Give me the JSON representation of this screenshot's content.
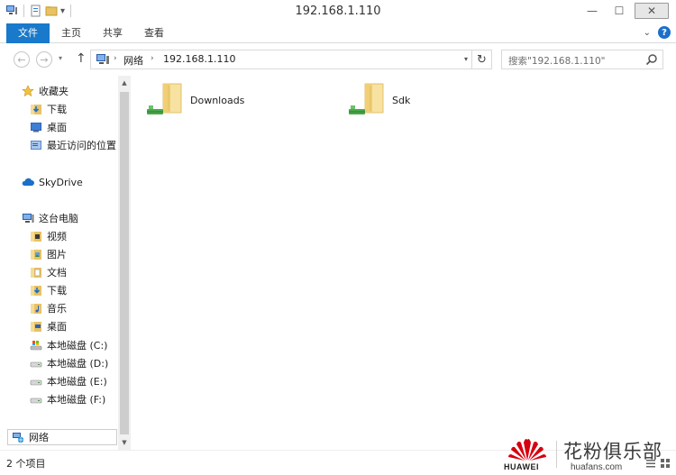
{
  "window": {
    "title": "192.168.1.110",
    "controls": {
      "minimize": "—",
      "maximize": "☐",
      "close": "✕"
    }
  },
  "ribbon": {
    "tabs": [
      "文件",
      "主页",
      "共享",
      "查看"
    ],
    "help_label": "?"
  },
  "address_bar": {
    "segments": [
      "网络",
      "192.168.1.110"
    ]
  },
  "search": {
    "placeholder": "搜索\"192.168.1.110\""
  },
  "nav_pane": {
    "favorites": {
      "label": "收藏夹",
      "items": [
        "下载",
        "桌面",
        "最近访问的位置"
      ]
    },
    "skydrive": {
      "label": "SkyDrive"
    },
    "this_pc": {
      "label": "这台电脑",
      "items": [
        "视频",
        "图片",
        "文档",
        "下载",
        "音乐",
        "桌面",
        "本地磁盘 (C:)",
        "本地磁盘 (D:)",
        "本地磁盘 (E:)",
        "本地磁盘 (F:)"
      ]
    },
    "network": {
      "label": "网络"
    }
  },
  "content": {
    "items": [
      {
        "name": "Downloads",
        "icon": "shared-folder-icon"
      },
      {
        "name": "Sdk",
        "icon": "shared-folder-icon"
      }
    ]
  },
  "status": {
    "item_count": "2 个项目"
  },
  "watermark": {
    "brand": "HUAWEI",
    "title": "花粉俱乐部",
    "url": "huafans.com"
  },
  "colors": {
    "accent": "#1979ca",
    "folder": "#e8c265",
    "share": "#3aa64a"
  }
}
